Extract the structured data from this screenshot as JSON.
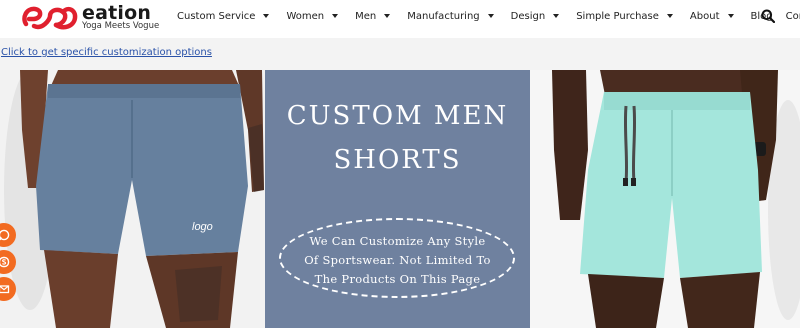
{
  "brand": {
    "name": "eation",
    "tagline": "Yoga Meets Vogue",
    "accent_color": "#e0202e"
  },
  "nav": {
    "items": [
      {
        "label": "Custom Service",
        "has_dropdown": true
      },
      {
        "label": "Women",
        "has_dropdown": true
      },
      {
        "label": "Men",
        "has_dropdown": true
      },
      {
        "label": "Manufacturing",
        "has_dropdown": true
      },
      {
        "label": "Design",
        "has_dropdown": true
      },
      {
        "label": "Simple Purchase",
        "has_dropdown": true
      },
      {
        "label": "About",
        "has_dropdown": true
      },
      {
        "label": "Blog",
        "has_dropdown": false
      },
      {
        "label": "Contact",
        "has_dropdown": false
      }
    ],
    "search_icon": "search-icon"
  },
  "subbar": {
    "link_text": "Click to get specific customization options"
  },
  "banner": {
    "title_line1": "CUSTOM MEN",
    "title_line2": "SHORTS",
    "subtitle_line1": "We Can Customize Any Style",
    "subtitle_line2": "Of Sportswear. Not Limited To",
    "subtitle_line3": "The Products On This Page",
    "left_shorts_label": "logo",
    "panel_color": "#6f819f",
    "left_shorts_color": "#66809e",
    "right_shorts_color": "#a4e6dc"
  },
  "floating_buttons": [
    {
      "icon": "whatsapp-icon"
    },
    {
      "icon": "skype-icon"
    },
    {
      "icon": "email-icon"
    }
  ],
  "colors": {
    "float_button": "#f26b21",
    "link": "#2a52a8"
  }
}
